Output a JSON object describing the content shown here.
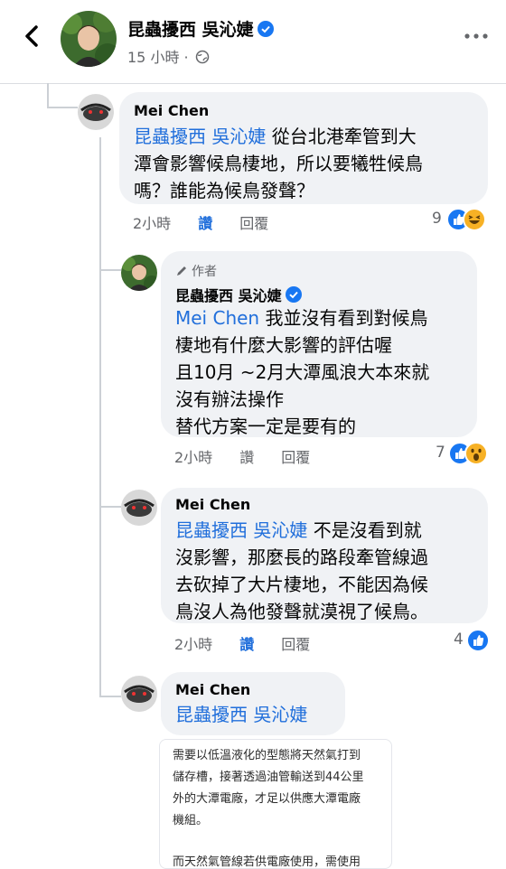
{
  "header": {
    "name": "昆蟲擾西 吳沁婕",
    "time": "15 小時 ·",
    "privacy_icon": "globe-icon",
    "more_icon": "ellipsis-icon",
    "back_icon": "back-arrow-icon"
  },
  "comments": [
    {
      "name": "Mei Chen",
      "mention": "昆蟲擾西 吳沁婕",
      "text_lines": [
        "從台北港牽管到大",
        "潭會影響候鳥棲地，所以要犧牲候鳥",
        "嗎？誰能為候鳥發聲？"
      ],
      "time": "2小時",
      "like": "讚",
      "reply": "回覆",
      "reaction_count": "9",
      "reactions": [
        "like",
        "haha"
      ]
    },
    {
      "author_tag": "作者",
      "name": "昆蟲擾西 吳沁婕",
      "mention": "Mei Chen",
      "text_lines": [
        "我並沒有看到對候鳥",
        "棲地有什麼大影響的評估喔",
        "且10月 ~2月大潭風浪大本來就",
        "沒有辦法操作",
        "替代方案一定是要有的"
      ],
      "time": "2小時",
      "like": "讚",
      "reply": "回覆",
      "reaction_count": "7",
      "reactions": [
        "like",
        "wow"
      ]
    },
    {
      "name": "Mei Chen",
      "mention": "昆蟲擾西 吳沁婕",
      "text_lines": [
        "不是沒看到就",
        "沒影響，那麼長的路段牽管線過",
        "去砍掉了大片棲地，不能因為候",
        "鳥沒人為他發聲就漠視了候鳥。"
      ],
      "time": "2小時",
      "like": "讚",
      "reply": "回覆",
      "reaction_count": "4",
      "reactions": [
        "like"
      ]
    },
    {
      "name": "Mei Chen",
      "mention": "昆蟲擾西 吳沁婕"
    }
  ],
  "attachment": {
    "line1": "需要以低溫液化的型態將天然氣打到",
    "line2": "儲存槽，接著透過油管輸送到44公里",
    "line3": "外的大潭電廠，才足以供應大潭電廠",
    "line4": "機組。",
    "line5": "而天然氣管線若供電廠使用，需使用"
  },
  "colors": {
    "mention": "#216fdb",
    "bubble": "#f0f2f5",
    "like_blue": "#1877f2",
    "meta_gray": "#65676b"
  }
}
